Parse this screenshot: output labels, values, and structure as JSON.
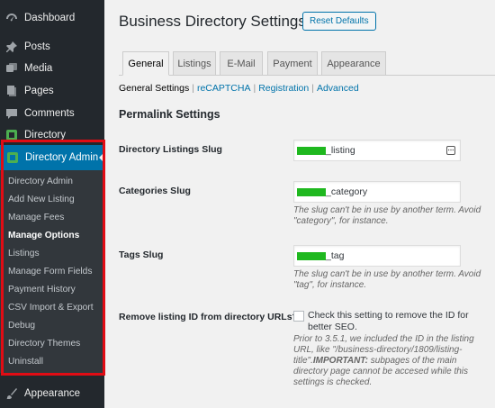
{
  "sidebar": {
    "items": {
      "dashboard": "Dashboard",
      "posts": "Posts",
      "media": "Media",
      "pages": "Pages",
      "comments": "Comments",
      "directory": "Directory",
      "appearance": "Appearance"
    },
    "directory_admin": {
      "label": "Directory Admin",
      "submenu": [
        "Directory Admin",
        "Add New Listing",
        "Manage Fees",
        "Manage Options",
        "Listings",
        "Manage Form Fields",
        "Payment History",
        "CSV Import & Export",
        "Debug",
        "Directory Themes",
        "Uninstall"
      ],
      "current": "Manage Options"
    }
  },
  "header": {
    "title": "Business Directory Settings",
    "reset_label": "Reset Defaults"
  },
  "tabs": [
    "General",
    "Listings",
    "E-Mail",
    "Payment",
    "Appearance"
  ],
  "active_tab": "General",
  "subnav": {
    "current": "General Settings",
    "links": [
      "reCAPTCHA",
      "Registration",
      "Advanced"
    ]
  },
  "section_title": "Permalink Settings",
  "fields": {
    "listings_slug": {
      "label": "Directory Listings Slug",
      "value_suffix": "_listing"
    },
    "categories_slug": {
      "label": "Categories Slug",
      "value_suffix": "_category",
      "description": "The slug can't be in use by another term. Avoid \"category\", for instance."
    },
    "tags_slug": {
      "label": "Tags Slug",
      "value_suffix": "_tag",
      "description": "The slug can't be in use by another term. Avoid \"tag\", for instance."
    },
    "remove_id": {
      "label": "Remove listing ID from directory URLs?",
      "checkbox_text": "Check this setting to remove the ID for better SEO.",
      "description_1": "Prior to 3.5.1, we included the ID in the listing URL, like \"/business-directory/1809/listing-title\".",
      "description_important": "IMPORTANT:",
      "description_2": " subpages of the main directory page cannot be accesed while this settings is checked.",
      "checked": false
    }
  },
  "colors": {
    "sidebar_bg": "#23282d",
    "submenu_bg": "#32373c",
    "accent": "#0073aa",
    "highlight_frame": "#e10c14",
    "redaction": "#1fb81f"
  }
}
